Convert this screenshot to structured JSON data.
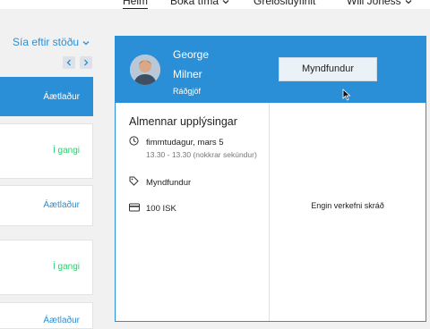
{
  "nav": {
    "home": "Heim",
    "book": "Bóka tíma",
    "payments": "Greiðsluyfirlit",
    "user": "Will Joness"
  },
  "filter": {
    "label": "Sía eftir stöðu"
  },
  "appointments": [
    {
      "status": "Áætlaður",
      "color": "#ffffff",
      "selected": true
    },
    {
      "status": "Í gangi",
      "color": "#2ecc71",
      "selected": false
    },
    {
      "status": "Áætlaður",
      "color": "#2a8fd6",
      "selected": false
    },
    {
      "status": "Í gangi",
      "color": "#2ecc71",
      "selected": false
    },
    {
      "status": "Áætlaður",
      "color": "#2a8fd6",
      "selected": false
    }
  ],
  "detail": {
    "first_name": "George",
    "last_name": "Milner",
    "role": "Ráðgjöf",
    "action_button": "Myndfundur",
    "section_title": "Almennar upplýsingar",
    "date": "fimmtudagur, mars 5",
    "time": "13.30 - 13.30 (nokkrar sekúndur)",
    "type": "Myndfundur",
    "price": "100 ISK",
    "empty_tasks": "Engin verkefni skráð"
  },
  "colors": {
    "accent": "#2a8fd6",
    "in_progress": "#2ecc71"
  }
}
